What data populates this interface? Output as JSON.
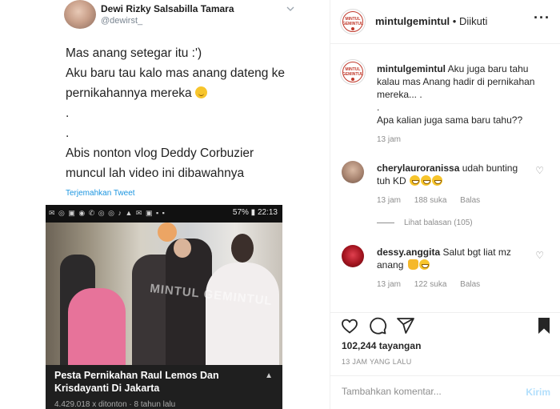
{
  "tweet": {
    "name": "Dewi Rizky Salsabilla Tamara",
    "handle": "@dewirst_",
    "lines": [
      "Mas anang setegar itu :')",
      "Aku baru tau kalo mas anang dateng ke",
      "pernikahannya mereka",
      ".",
      ".",
      "Abis nonton vlog Deddy Corbuzier",
      "muncul lah video ini dibawahnya"
    ],
    "translate": "Terjemahkan Tweet"
  },
  "phone": {
    "status_right": "57% ▮ 22:13",
    "watermark": "MINTUL GEMINTUL",
    "video_title": "Pesta Pernikahan Raul Lemos Dan Krisdayanti Di Jakarta",
    "video_meta": "4.429.018 x ditonton · 8 tahun lalu"
  },
  "header": {
    "username": "mintulgemintul",
    "follow_status": " • Diikuti",
    "avatar_text": "MINTUL GEMINTUL",
    "more_icon": "more-horizontal-icon"
  },
  "caption": {
    "username": "mintulgemintul",
    "text1": "Aku juga baru tahu kalau mas Anang hadir di pernikahan mereka... .",
    "text2": ".",
    "text3": "Apa kalian juga sama baru tahu??",
    "time": "13 jam"
  },
  "comments": [
    {
      "username": "cherylauroranissa",
      "text": "udah bunting tuh KD",
      "time": "13 jam",
      "likes": "188 suka",
      "reply": "Balas"
    },
    {
      "username": "dessy.anggita",
      "text": "Salut bgt liat mz anang",
      "time": "13 jam",
      "likes": "122 suka",
      "reply": "Balas"
    }
  ],
  "view_replies": "Lihat balasan (105)",
  "actions": {
    "views": "102,244 tayangan",
    "date": "13 JAM YANG LALU",
    "comment_placeholder": "Tambahkan komentar...",
    "post_label": "Kirim"
  },
  "colors": {
    "accent_link": "#1b95e0",
    "post_button_disabled": "#b2dffc",
    "brand_red": "#c0392b"
  }
}
